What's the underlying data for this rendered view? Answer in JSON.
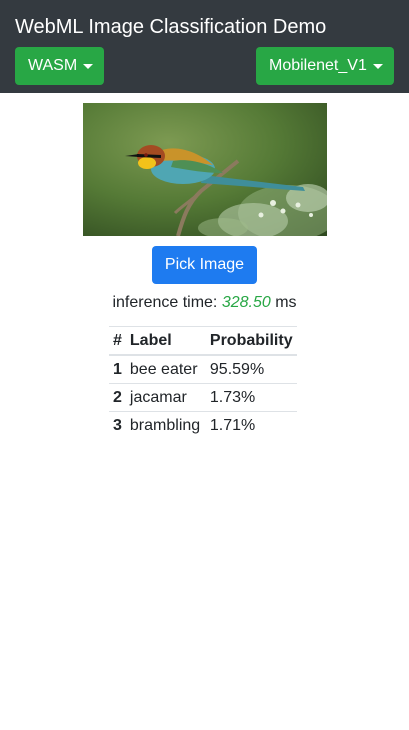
{
  "header": {
    "title": "WebML Image Classification Demo",
    "backend_button": "WASM",
    "model_button": "Mobilenet_V1"
  },
  "main": {
    "pick_button": "Pick Image",
    "inference_label": "inference time:",
    "inference_value": "328.50",
    "inference_unit": "ms"
  },
  "results": {
    "headers": [
      "#",
      "Label",
      "Probability"
    ],
    "rows": [
      {
        "rank": "1",
        "label": "bee eater",
        "probability": "95.59%"
      },
      {
        "rank": "2",
        "label": "jacamar",
        "probability": "1.73%"
      },
      {
        "rank": "3",
        "label": "brambling",
        "probability": "1.71%"
      }
    ]
  },
  "colors": {
    "navbar": "#343a40",
    "success": "#28a745",
    "primary": "#1e7bf0"
  },
  "icons": [
    "caret-down-icon",
    "bird-photo"
  ]
}
